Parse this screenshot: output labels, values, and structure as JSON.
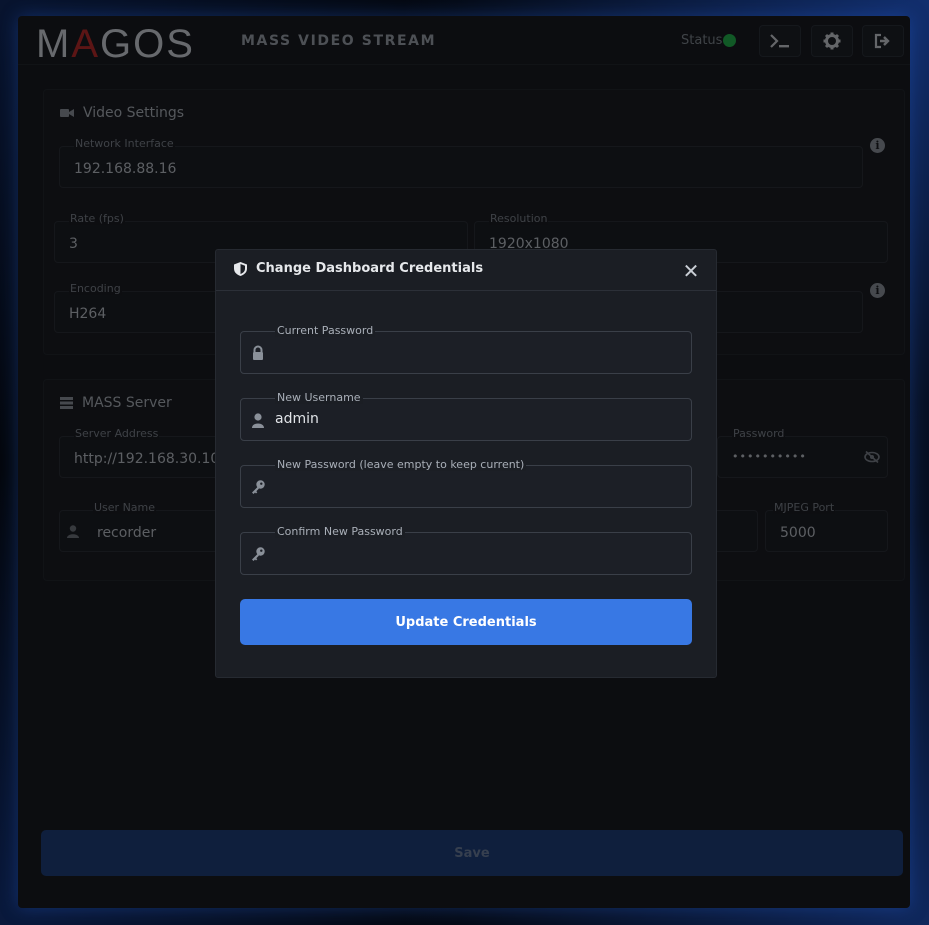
{
  "header": {
    "logo_pre": "M",
    "logo_a": "A",
    "logo_post": "GOS",
    "subtitle": "MASS VIDEO STREAM",
    "status_label": "Status:",
    "status_color": "#22b24c",
    "buttons": [
      "terminal-icon",
      "gear-icon",
      "logout-icon"
    ]
  },
  "video_settings": {
    "title": "Video Settings",
    "network_interface": {
      "label": "Network Interface",
      "value": "192.168.88.16"
    },
    "rate": {
      "label": "Rate (fps)",
      "value": "3"
    },
    "resolution": {
      "label": "Resolution",
      "value": "1920x1080"
    },
    "encoding": {
      "label": "Encoding",
      "value": "H264"
    }
  },
  "mass_server": {
    "title": "MASS Server",
    "server_address": {
      "label": "Server Address",
      "value": "http://192.168.30.10"
    },
    "password": {
      "label": "Password",
      "value": "••••••••••"
    },
    "user_name": {
      "label": "User Name",
      "value": "recorder"
    },
    "mjpeg_port": {
      "label": "MJPEG Port",
      "value": "5000"
    }
  },
  "save_label": "Save",
  "modal": {
    "title": "Change Dashboard Credentials",
    "close_symbol": "✕",
    "current_password": {
      "label": "Current Password",
      "value": ""
    },
    "new_username": {
      "label": "New Username",
      "value": "admin"
    },
    "new_password": {
      "label": "New Password (leave empty to keep current)",
      "value": ""
    },
    "confirm_password": {
      "label": "Confirm New Password",
      "value": ""
    },
    "submit_label": "Update Credentials",
    "accent": "#3878e4"
  }
}
